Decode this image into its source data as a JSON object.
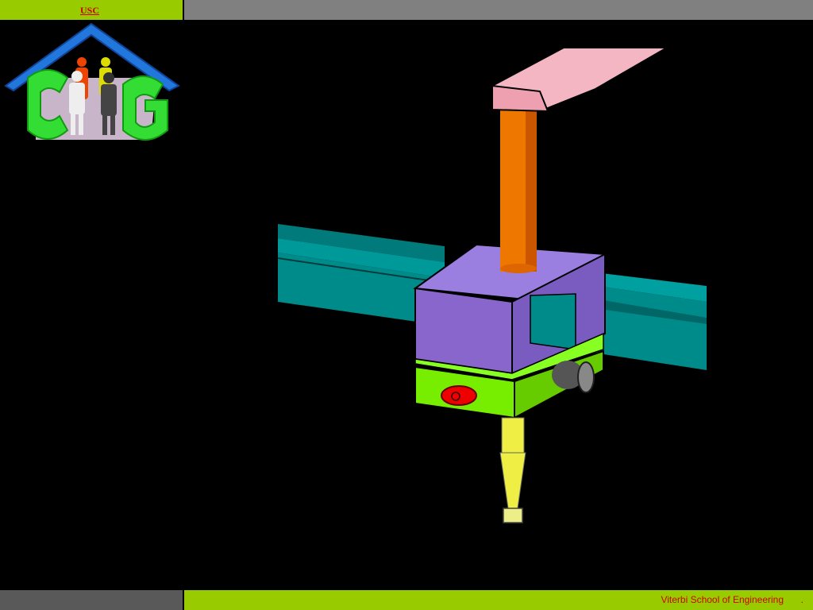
{
  "header": {
    "link_text": "USC",
    "left_bar_color": "#99cc00",
    "right_bar_color": "#808080"
  },
  "footer": {
    "text": "Viterbi School of Engineering",
    "trailing": ".",
    "left_bar_color": "#595959",
    "right_bar_color": "#99cc00",
    "text_color": "#cc0000"
  },
  "logo": {
    "icon": "house-people-logo",
    "letters_color": "#33dd33",
    "roof_color": "#2277dd"
  },
  "illustration": {
    "icon": "gantry-robot-3d-model",
    "colors": {
      "arm": "#f4b6c2",
      "column": "#ee7700",
      "carriage": "#8866cc",
      "rails": "#008b8b",
      "tool_block": "#77ee00",
      "knob": "#555555",
      "button": "#ee0000",
      "nozzle": "#eeee44"
    }
  }
}
